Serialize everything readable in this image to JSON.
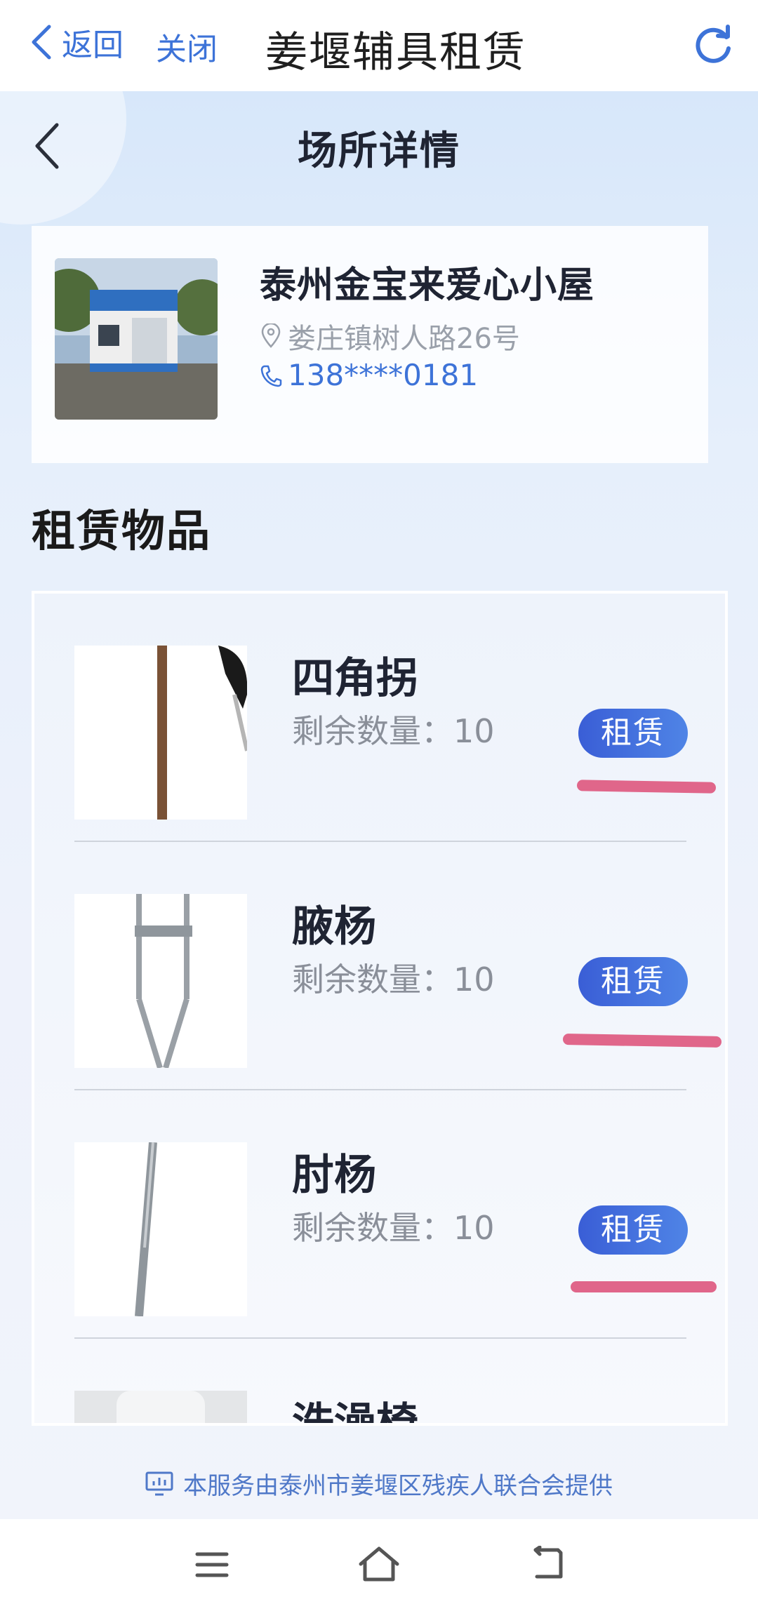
{
  "topbar": {
    "back_label": "返回",
    "close_label": "关闭",
    "title": "姜堰辅具租赁"
  },
  "page": {
    "title": "场所详情"
  },
  "venue": {
    "name": "泰州金宝来爱心小屋",
    "address": "娄庄镇树人路26号",
    "phone": "138****0181"
  },
  "section": {
    "title": "租赁物品"
  },
  "items": [
    {
      "name": "四角拐",
      "qty": "剩余数量：10",
      "button": "租赁"
    },
    {
      "name": "腋杨",
      "qty": "剩余数量：10",
      "button": "租赁"
    },
    {
      "name": "肘杨",
      "qty": "剩余数量：10",
      "button": "租赁"
    },
    {
      "name": "洗澡椅",
      "qty": "",
      "button": ""
    }
  ],
  "footer": {
    "note": "本服务由泰州市姜堰区残疾人联合会提供"
  },
  "colors": {
    "accent": "#3d73d8",
    "button_start": "#3a5ed6",
    "button_end": "#4f84e6",
    "underline": "#e0668a"
  },
  "icons": {
    "back": "chevron-left-icon",
    "refresh": "refresh-icon",
    "location": "location-pin-icon",
    "phone": "phone-icon",
    "service": "monitor-chart-icon",
    "menu": "menu-icon",
    "home": "home-icon",
    "return": "return-icon"
  }
}
